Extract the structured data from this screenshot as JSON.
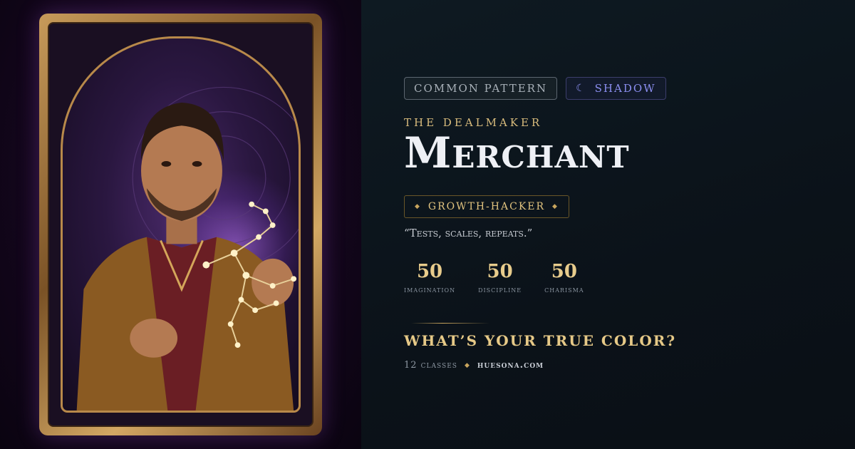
{
  "card": {
    "icons": [
      "constellation-icon"
    ]
  },
  "tags": {
    "common_label": "COMMON PATTERN",
    "shadow_icon": "crescent-moon-icon",
    "shadow_label": "SHADOW"
  },
  "class": {
    "subtitle": "THE DEALMAKER",
    "title": "Merchant",
    "trait": "GROWTH-HACKER",
    "motto": "“Tests, scales, repeats.”"
  },
  "stats": [
    {
      "value": "50",
      "label": "imagination"
    },
    {
      "value": "50",
      "label": "discipline"
    },
    {
      "value": "50",
      "label": "charisma"
    }
  ],
  "cta": {
    "headline": "WHAT’S YOUR TRUE COLOR?",
    "count": "12 classes",
    "site": "huesona.com"
  },
  "colors": {
    "gold": "#e6c987",
    "shadow_accent": "#8b8ef0",
    "background": "#0b1117"
  }
}
